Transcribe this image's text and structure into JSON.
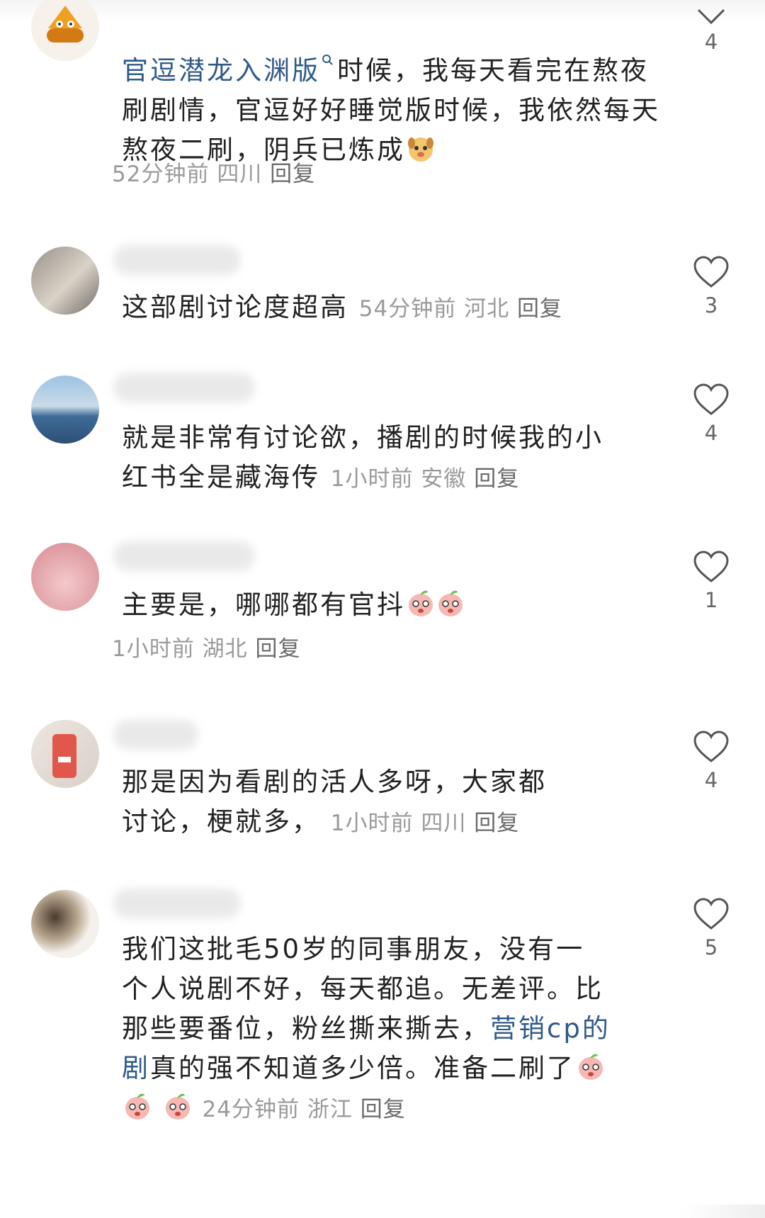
{
  "comments": [
    {
      "pre_link": "官逗潜龙入渊版",
      "text": "时候，我每天看完在熬夜刷剧情，官逗好好睡觉版时候，我依然每天熬夜二刷，阴兵已炼成",
      "time": "52分钟前",
      "region": "四川",
      "reply": "回复",
      "likes": "4"
    },
    {
      "text": "这部剧讨论度超高",
      "time": "54分钟前",
      "region": "河北",
      "reply": "回复",
      "likes": "3"
    },
    {
      "text": "就是非常有讨论欲，播剧的时候我的小红书全是藏海传",
      "time": "1小时前",
      "region": "安徽",
      "reply": "回复",
      "likes": "4"
    },
    {
      "text": "主要是，哪哪都有官抖",
      "time": "1小时前",
      "region": "湖北",
      "reply": "回复",
      "likes": "1"
    },
    {
      "text": "那是因为看剧的活人多呀，大家都讨论，梗就多，",
      "time": "1小时前",
      "region": "四川",
      "reply": "回复",
      "likes": "4"
    },
    {
      "text": "我们这批毛50岁的同事朋友，没有一个人说剧不好，每天都追。无差评。比那些要番位，粉丝撕来撕去，",
      "link": "营销cp的剧",
      "text_after": "真的强不知道多少倍。准备二刷了",
      "time": "24分钟前",
      "region": "浙江",
      "reply": "回复",
      "likes": "5"
    }
  ],
  "icons": {
    "like": "heart-outline-icon",
    "search": "search-icon",
    "emoji_dog": "dog-face-emoji",
    "emoji_peach": "peach-face-emoji"
  },
  "colors": {
    "text": "#222222",
    "meta": "#9a9a9a",
    "link": "#2f5a88"
  }
}
